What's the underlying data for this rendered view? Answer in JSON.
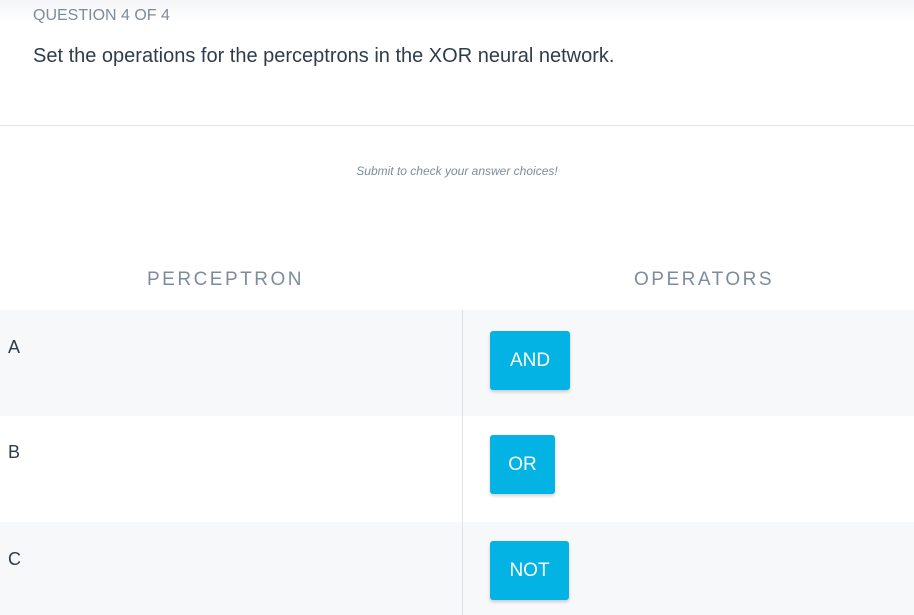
{
  "question": {
    "counter": "QUESTION 4 OF 4",
    "text": "Set the operations for the perceptrons in the XOR neural network."
  },
  "hint": "Submit to check your answer choices!",
  "columns": {
    "left": "PERCEPTRON",
    "right": "OPERATORS"
  },
  "rows": [
    {
      "label": "A",
      "operator": "AND"
    },
    {
      "label": "B",
      "operator": "OR"
    },
    {
      "label": "C",
      "operator": "NOT"
    }
  ],
  "colors": {
    "accent": "#02b3e4",
    "text_dark": "#2e3d49",
    "text_muted": "#7d8c9b"
  }
}
